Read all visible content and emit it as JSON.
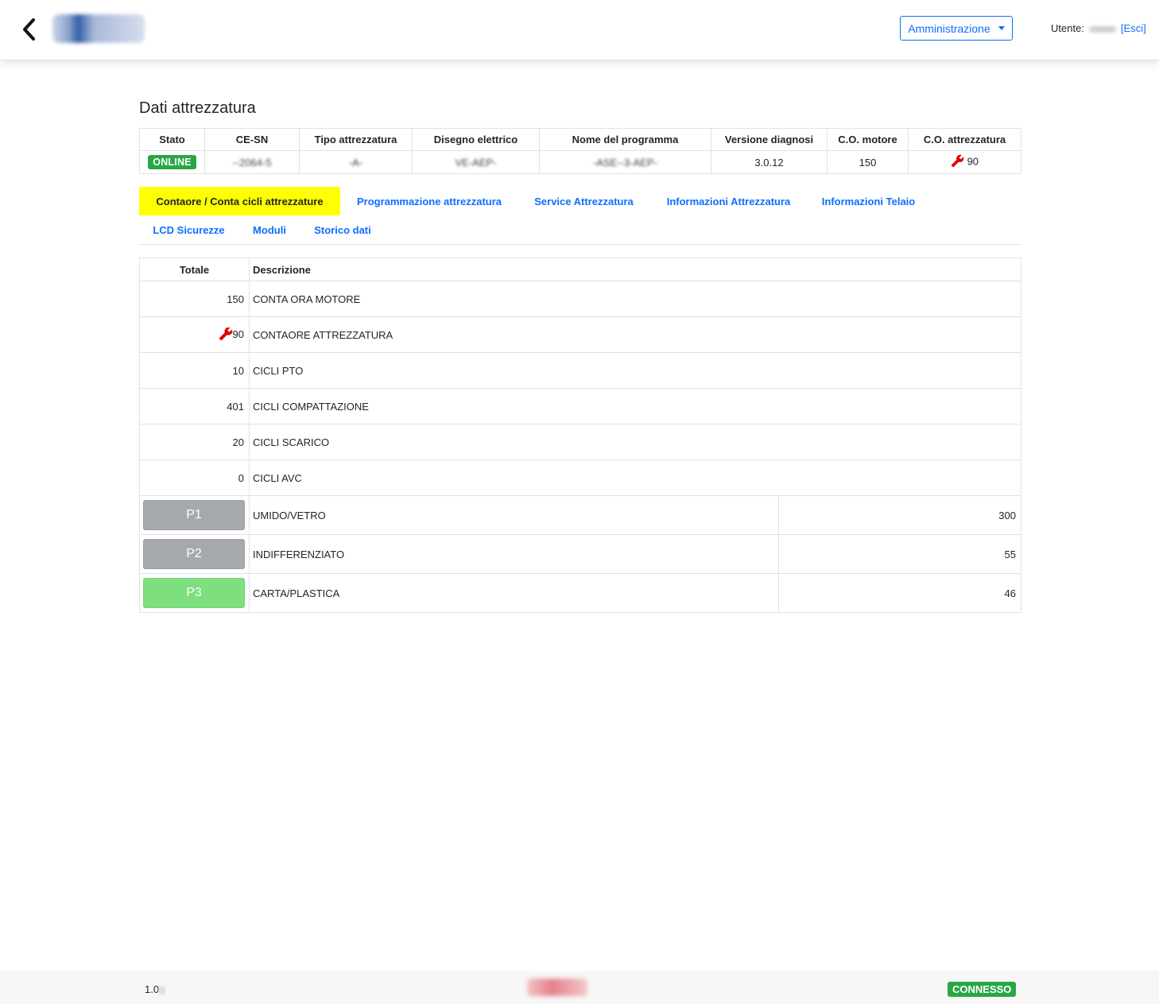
{
  "header": {
    "admin_label": "Amministrazione",
    "user_label": "Utente:",
    "logout_label": "[Esci]"
  },
  "page_title": "Dati attrezzatura",
  "equipment": {
    "headers": [
      "Stato",
      "CE-SN",
      "Tipo attrezzatura",
      "Disegno elettrico",
      "Nome del programma",
      "Versione diagnosi",
      "C.O. motore",
      "C.O. attrezzatura"
    ],
    "status": "ONLINE",
    "ce_sn": "--2064-5",
    "tipo": "-A-",
    "disegno": "VE-AEP-",
    "programma": "-ASE--3-AEP-",
    "versione": "3.0.12",
    "co_motore": "150",
    "co_attrezzatura": "90"
  },
  "tabs": [
    {
      "label": "Contaore / Conta cicli attrezzature",
      "active": true
    },
    {
      "label": "Programmazione attrezzatura"
    },
    {
      "label": "Service Attrezzatura"
    },
    {
      "label": "Informazioni Attrezzatura"
    },
    {
      "label": "Informazioni Telaio"
    },
    {
      "label": "LCD Sicurezze"
    },
    {
      "label": "Moduli"
    },
    {
      "label": "Storico dati"
    }
  ],
  "counters": {
    "headers": {
      "total": "Totale",
      "description": "Descrizione"
    },
    "rows": [
      {
        "value": "150",
        "label": "CONTA ORA MOTORE"
      },
      {
        "value": "90",
        "label": "CONTAORE ATTREZZATURA",
        "icon": "wrench-icon"
      },
      {
        "value": "10",
        "label": "CICLI PTO"
      },
      {
        "value": "401",
        "label": "CICLI COMPATTAZIONE"
      },
      {
        "value": "20",
        "label": "CICLI SCARICO"
      },
      {
        "value": "0",
        "label": "CICLI AVC"
      }
    ],
    "programs": [
      {
        "name": "P1",
        "label": "UMIDO/VETRO",
        "value": "300",
        "color": "#a5a8ad"
      },
      {
        "name": "P2",
        "label": "INDIFFERENZIATO",
        "value": "55",
        "color": "#a5a8ad"
      },
      {
        "name": "P3",
        "label": "CARTA/PLASTICA",
        "value": "46",
        "color": "#7ddf7d"
      }
    ]
  },
  "footer": {
    "version": "1.0",
    "status": "CONNESSO"
  },
  "colors": {
    "accent": "#0d6efd",
    "active_tab": "#ffff00",
    "online": "#28a745",
    "wrench": "#e00000"
  }
}
